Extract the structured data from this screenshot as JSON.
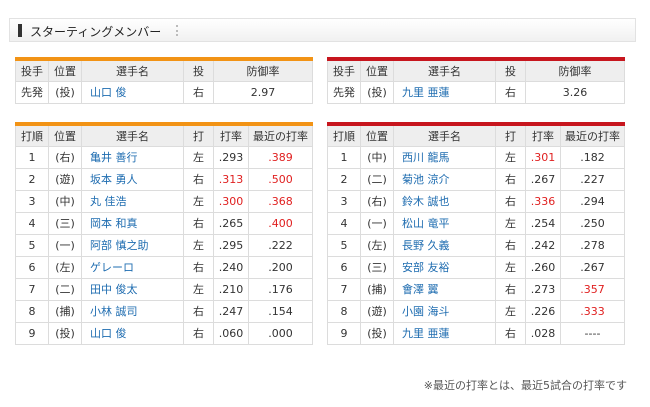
{
  "header": {
    "title": "スターティングメンバー"
  },
  "pitcher_headers": [
    "投手",
    "位置",
    "選手名",
    "投",
    "防御率"
  ],
  "lineup_headers": [
    "打順",
    "位置",
    "選手名",
    "打",
    "打率",
    "最近の打率"
  ],
  "left": {
    "pitcher": {
      "role": "先発",
      "pos": "(投)",
      "name": "山口 俊",
      "throws": "右",
      "era": "2.97"
    },
    "lineup": [
      {
        "order": "1",
        "pos": "(右)",
        "name": "亀井 善行",
        "bats": "左",
        "avg": ".293",
        "avg_hl": false,
        "recent": ".389",
        "recent_hl": true
      },
      {
        "order": "2",
        "pos": "(遊)",
        "name": "坂本 勇人",
        "bats": "右",
        "avg": ".313",
        "avg_hl": true,
        "recent": ".500",
        "recent_hl": true
      },
      {
        "order": "3",
        "pos": "(中)",
        "name": "丸 佳浩",
        "bats": "左",
        "avg": ".300",
        "avg_hl": true,
        "recent": ".368",
        "recent_hl": true
      },
      {
        "order": "4",
        "pos": "(三)",
        "name": "岡本 和真",
        "bats": "右",
        "avg": ".265",
        "avg_hl": false,
        "recent": ".400",
        "recent_hl": true
      },
      {
        "order": "5",
        "pos": "(一)",
        "name": "阿部 慎之助",
        "bats": "左",
        "avg": ".295",
        "avg_hl": false,
        "recent": ".222",
        "recent_hl": false
      },
      {
        "order": "6",
        "pos": "(左)",
        "name": "ゲレーロ",
        "bats": "右",
        "avg": ".240",
        "avg_hl": false,
        "recent": ".200",
        "recent_hl": false
      },
      {
        "order": "7",
        "pos": "(二)",
        "name": "田中 俊太",
        "bats": "左",
        "avg": ".210",
        "avg_hl": false,
        "recent": ".176",
        "recent_hl": false
      },
      {
        "order": "8",
        "pos": "(捕)",
        "name": "小林 誠司",
        "bats": "右",
        "avg": ".247",
        "avg_hl": false,
        "recent": ".154",
        "recent_hl": false
      },
      {
        "order": "9",
        "pos": "(投)",
        "name": "山口 俊",
        "bats": "右",
        "avg": ".060",
        "avg_hl": false,
        "recent": ".000",
        "recent_hl": false
      }
    ]
  },
  "right": {
    "pitcher": {
      "role": "先発",
      "pos": "(投)",
      "name": "九里 亜蓮",
      "throws": "右",
      "era": "3.26"
    },
    "lineup": [
      {
        "order": "1",
        "pos": "(中)",
        "name": "西川 龍馬",
        "bats": "左",
        "avg": ".301",
        "avg_hl": true,
        "recent": ".182",
        "recent_hl": false
      },
      {
        "order": "2",
        "pos": "(二)",
        "name": "菊池 涼介",
        "bats": "右",
        "avg": ".267",
        "avg_hl": false,
        "recent": ".227",
        "recent_hl": false
      },
      {
        "order": "3",
        "pos": "(右)",
        "name": "鈴木 誠也",
        "bats": "右",
        "avg": ".336",
        "avg_hl": true,
        "recent": ".294",
        "recent_hl": false
      },
      {
        "order": "4",
        "pos": "(一)",
        "name": "松山 竜平",
        "bats": "左",
        "avg": ".254",
        "avg_hl": false,
        "recent": ".250",
        "recent_hl": false
      },
      {
        "order": "5",
        "pos": "(左)",
        "name": "長野 久義",
        "bats": "右",
        "avg": ".242",
        "avg_hl": false,
        "recent": ".278",
        "recent_hl": false
      },
      {
        "order": "6",
        "pos": "(三)",
        "name": "安部 友裕",
        "bats": "左",
        "avg": ".260",
        "avg_hl": false,
        "recent": ".267",
        "recent_hl": false
      },
      {
        "order": "7",
        "pos": "(捕)",
        "name": "會澤 翼",
        "bats": "右",
        "avg": ".273",
        "avg_hl": false,
        "recent": ".357",
        "recent_hl": true
      },
      {
        "order": "8",
        "pos": "(遊)",
        "name": "小園 海斗",
        "bats": "左",
        "avg": ".226",
        "avg_hl": false,
        "recent": ".333",
        "recent_hl": true
      },
      {
        "order": "9",
        "pos": "(投)",
        "name": "九里 亜蓮",
        "bats": "右",
        "avg": ".028",
        "avg_hl": false,
        "recent": "----",
        "recent_hl": false
      }
    ]
  },
  "footnote": "※最近の打率とは、最近5試合の打率です",
  "colors": {
    "home_accent": "#f29315",
    "away_accent": "#c7161e",
    "link": "#1e6cb0",
    "highlight": "#e02020"
  }
}
